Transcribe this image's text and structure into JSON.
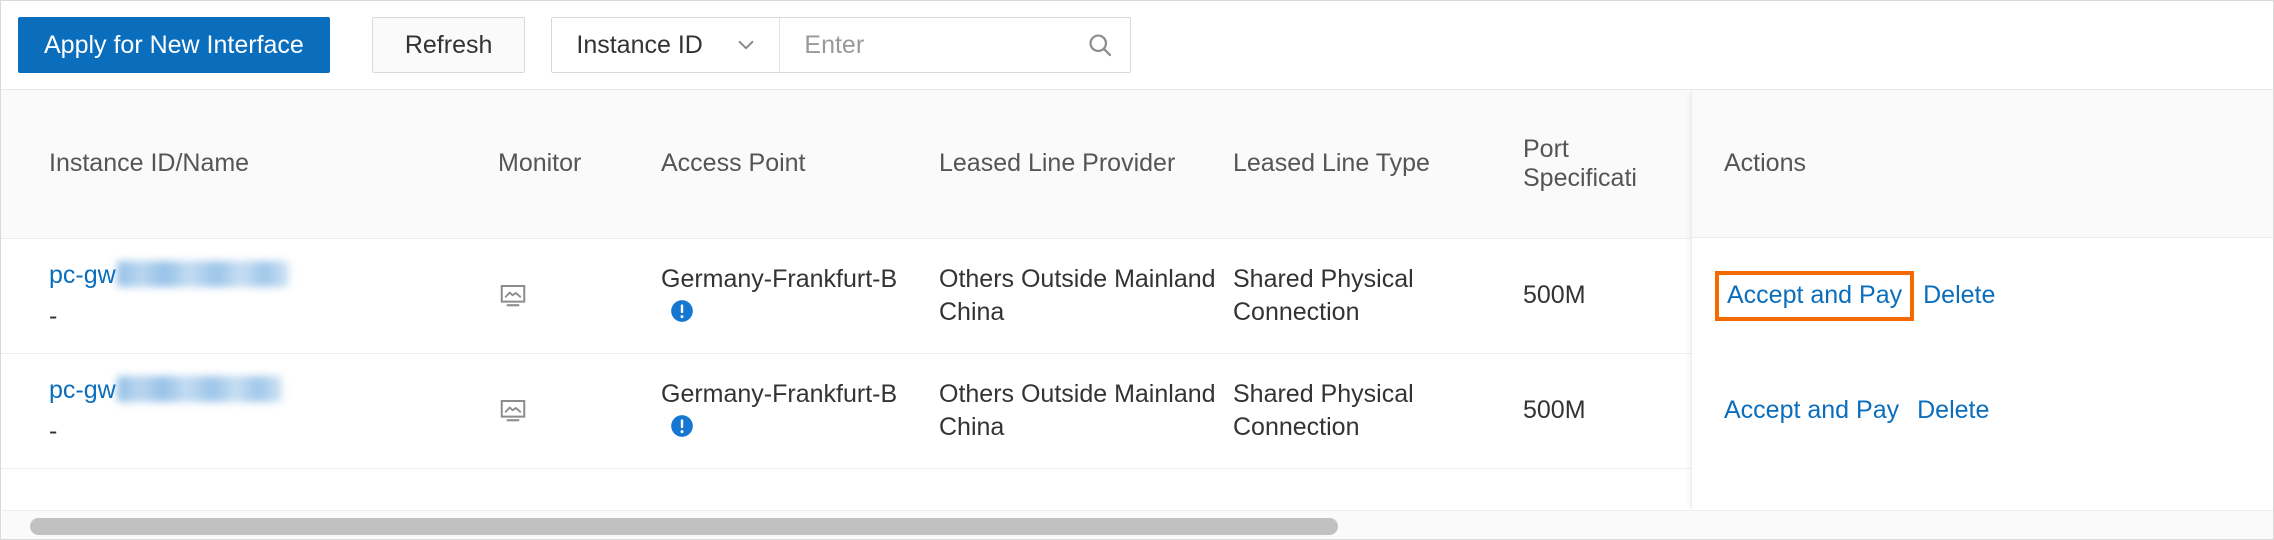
{
  "toolbar": {
    "apply_button": "Apply for New Interface",
    "refresh_button": "Refresh",
    "filter_select_value": "Instance ID",
    "search_placeholder": "Enter",
    "search_value": ""
  },
  "table": {
    "headers": {
      "instance": "Instance ID/Name",
      "monitor": "Monitor",
      "access_point": "Access Point",
      "provider": "Leased Line Provider",
      "type": "Leased Line Type",
      "port": "Port Specificati",
      "actions": "Actions"
    },
    "rows": [
      {
        "id_prefix": "pc-gw",
        "name": "-",
        "access_point": "Germany-Frankfurt-B",
        "provider": "Others Outside Mainland China",
        "line_type": "Shared Physical Connection",
        "port_spec": "500M",
        "accept_label": "Accept and Pay",
        "delete_label": "Delete"
      },
      {
        "id_prefix": "pc-gw",
        "name": "-",
        "access_point": "Germany-Frankfurt-B",
        "provider": "Others Outside Mainland China",
        "line_type": "Shared Physical Connection",
        "port_spec": "500M",
        "accept_label": "Accept and Pay",
        "delete_label": "Delete"
      }
    ]
  },
  "colors": {
    "primary_blue": "#0a6ebd",
    "link_blue": "#0a6ebd",
    "highlight_orange": "#f56a00",
    "info_badge_blue": "#1677d2",
    "header_bg": "#fafafa"
  },
  "icons": {
    "chevron": "chevron-down-icon",
    "search": "search-icon",
    "monitor": "monitor-chart-icon",
    "info": "info-circle-icon"
  }
}
